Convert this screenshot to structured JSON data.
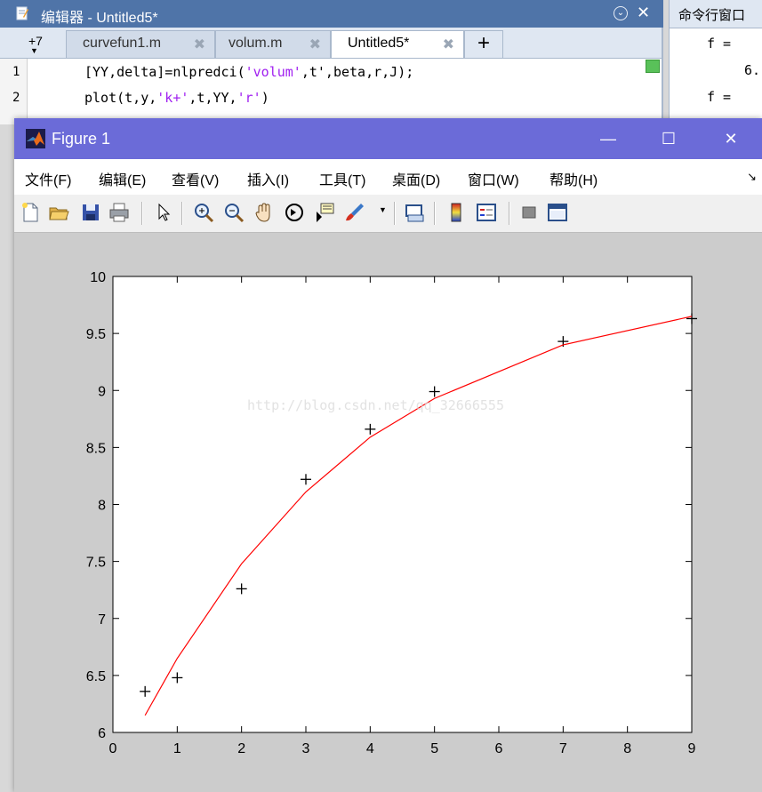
{
  "editor": {
    "title": "编辑器 - Untitled5*",
    "nav": "+7",
    "tabs": [
      {
        "label": "curvefun1.m",
        "active": false
      },
      {
        "label": "volum.m",
        "active": false
      },
      {
        "label": "Untitled5*",
        "active": true
      }
    ],
    "add_tab": "+",
    "lines": [
      {
        "num": "1",
        "pre": "[YY,delta]=nlpredci(",
        "s1": "'volum'",
        "mid": ",t',beta,r,J);",
        "s2": "",
        "post": ""
      },
      {
        "num": "2",
        "pre": "plot(t,y,",
        "s1": "'k+'",
        "mid": ",t,YY,",
        "s2": "'r'",
        "post": ")"
      }
    ]
  },
  "command_window": {
    "title": "命令行窗口",
    "lines": [
      "f =",
      "6.",
      "f ="
    ]
  },
  "figure": {
    "title": "Figure 1",
    "controls": {
      "minimize": "—",
      "maximize": "☐",
      "close": "✕"
    },
    "menus": [
      "文件(F)",
      "编辑(E)",
      "查看(V)",
      "插入(I)",
      "工具(T)",
      "桌面(D)",
      "窗口(W)",
      "帮助(H)"
    ],
    "menu_overflow": "↘",
    "toolbar_icons": [
      "new-file-icon",
      "open-folder-icon",
      "save-icon",
      "print-icon",
      "pointer-icon",
      "zoom-in-icon",
      "zoom-out-icon",
      "pan-hand-icon",
      "rotate-3d-icon",
      "data-cursor-icon",
      "brush-icon",
      "link-plot-icon",
      "colorbar-icon",
      "legend-icon",
      "hide-plot-tools-icon",
      "show-plot-tools-icon"
    ],
    "watermark": "http://blog.csdn.net/qq_32666555"
  },
  "colors": {
    "editor_title_bg": "#4f74a8",
    "figure_title_bg": "#6b6bd8",
    "fit_line": "#ff0000",
    "markers": "#000000",
    "string_literal": "#a020f0"
  },
  "chart_data": {
    "type": "scatter",
    "xlim": [
      0,
      9
    ],
    "ylim": [
      6,
      10
    ],
    "xticks": [
      "0",
      "1",
      "2",
      "3",
      "4",
      "5",
      "6",
      "7",
      "8",
      "9"
    ],
    "yticks": [
      "6",
      "6.5",
      "7",
      "7.5",
      "8",
      "8.5",
      "9",
      "9.5",
      "10"
    ],
    "grid": false,
    "title": "",
    "xlabel": "",
    "ylabel": "",
    "series": [
      {
        "style": "k+",
        "color": "#000000",
        "points": [
          {
            "x": 0.5,
            "y": 6.36
          },
          {
            "x": 1,
            "y": 6.48
          },
          {
            "x": 2,
            "y": 7.26
          },
          {
            "x": 3,
            "y": 8.22
          },
          {
            "x": 4,
            "y": 8.66
          },
          {
            "x": 5,
            "y": 8.99
          },
          {
            "x": 7,
            "y": 9.43
          },
          {
            "x": 9,
            "y": 9.63
          }
        ]
      },
      {
        "style": "r-",
        "color": "#ff0000",
        "points": [
          {
            "x": 0.5,
            "y": 6.15
          },
          {
            "x": 1,
            "y": 6.65
          },
          {
            "x": 2,
            "y": 7.48
          },
          {
            "x": 3,
            "y": 8.11
          },
          {
            "x": 4,
            "y": 8.59
          },
          {
            "x": 5,
            "y": 8.93
          },
          {
            "x": 7,
            "y": 9.4
          },
          {
            "x": 9,
            "y": 9.65
          }
        ]
      }
    ]
  }
}
